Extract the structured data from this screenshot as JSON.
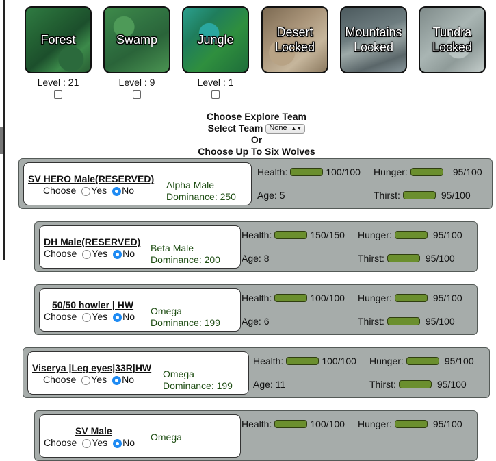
{
  "areas": [
    {
      "id": "forest",
      "label": "Forest",
      "level_text": "Level : 21"
    },
    {
      "id": "swamp",
      "label": "Swamp",
      "level_text": "Level : 9"
    },
    {
      "id": "jungle",
      "label": "Jungle",
      "level_text": "Level : 1"
    },
    {
      "id": "desert",
      "label": "Desert\nLocked",
      "level_text": ""
    },
    {
      "id": "mountains",
      "label": "Mountains\nLocked",
      "level_text": ""
    },
    {
      "id": "tundra",
      "label": "Tundra\nLocked",
      "level_text": ""
    }
  ],
  "team": {
    "choose_team": "Choose Explore Team",
    "select_team": "Select Team",
    "select_value": "None",
    "or": "Or",
    "choose_six": "Choose Up To Six Wolves"
  },
  "labels": {
    "choose": "Choose",
    "yes": "Yes",
    "no": "No",
    "health": "Health:",
    "hunger": "Hunger:",
    "age": "Age:",
    "thirst": "Thirst:"
  },
  "wolves": [
    {
      "name": "SV HERO Male(RESERVED)",
      "rank": "Alpha Male",
      "dominance": "Dominance: 250",
      "choice": "no",
      "health": "100/100",
      "hunger": "95/100",
      "age": "5",
      "thirst": "95/100"
    },
    {
      "name": "DH Male(RESERVED)",
      "rank": "Beta Male",
      "dominance": "Dominance: 200",
      "choice": "no",
      "health": "150/150",
      "hunger": "95/100",
      "age": "8",
      "thirst": "95/100"
    },
    {
      "name": "50/50 howler | HW",
      "rank": "Omega",
      "dominance": "Dominance: 199",
      "choice": "no",
      "health": "100/100",
      "hunger": "95/100",
      "age": "6",
      "thirst": "95/100"
    },
    {
      "name": "Viserya |Leg eyes|33R|HW",
      "rank": "Omega",
      "dominance": "Dominance: 199",
      "choice": "no",
      "health": "100/100",
      "hunger": "95/100",
      "age": "11",
      "thirst": "95/100"
    },
    {
      "name": "SV Male",
      "rank": "Omega",
      "dominance": "",
      "choice": "no",
      "health": "100/100",
      "hunger": "95/100",
      "age": "",
      "thirst": ""
    }
  ]
}
